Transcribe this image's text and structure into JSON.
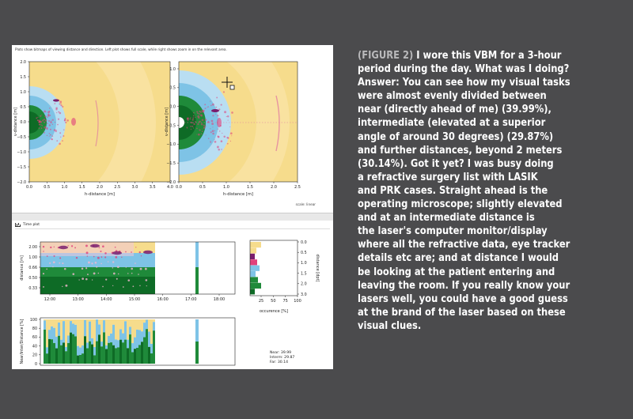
{
  "figure": {
    "header": "Plots show bitmaps of viewing distance and direction. Left plot shows full scale, while right shows zoom in on the relevant area.",
    "timeplot_title": "Time plot",
    "scale_label": "scale: linear"
  },
  "chart_data": [
    {
      "type": "heatmap",
      "title": "",
      "xlabel": "h-distance [m]",
      "ylabel": "v-distance [m]",
      "xlim": [
        0.0,
        4.0
      ],
      "ylim": [
        -2.0,
        2.0
      ],
      "xticks": [
        "0.0",
        "0.5",
        "1.0",
        "1.5",
        "2.0",
        "2.5",
        "3.0",
        "3.5",
        "4.0"
      ],
      "yticks": [
        "2.0",
        "1.5",
        "1.0",
        "0.5",
        "0.0",
        "−0.5",
        "−1.0",
        "−1.5",
        "−2.0"
      ]
    },
    {
      "type": "heatmap",
      "title": "",
      "xlabel": "h-distance [m]",
      "ylabel": "v-distance [m]",
      "xlim": [
        0.0,
        2.5
      ],
      "ylim": [
        -2.0,
        2.0
      ],
      "xticks": [
        "0.0",
        "0.5",
        "1.0",
        "1.5",
        "2.0",
        "2.5"
      ],
      "yticks": [
        "1.0",
        "0.5",
        "0.0",
        "−0.5",
        "−1.0",
        "−1.5",
        "−2.0"
      ]
    },
    {
      "type": "heatmap",
      "title": "Time plot",
      "xlabel": "",
      "ylabel": "distance [m]",
      "x": [
        "12:00",
        "13:00",
        "14:00",
        "15:00",
        "16:00",
        "17:00",
        "18:00"
      ],
      "yticks": [
        "2.00",
        "1.00",
        "0.66",
        "0.50",
        "0.33"
      ]
    },
    {
      "type": "bar",
      "title": "",
      "xlabel": "occurence [%]",
      "ylabel": "distance [dpt]",
      "xticks": [
        "25",
        "50",
        "75",
        "100"
      ],
      "yticks": [
        "0.0",
        "0.5",
        "1.0",
        "1.5",
        "2.0",
        "3.0"
      ]
    },
    {
      "type": "area",
      "title": "",
      "xlabel": "",
      "ylabel": "Near/Inter/Distance [%]",
      "yticks": [
        "100",
        "80",
        "60",
        "40",
        "20",
        "0"
      ],
      "series": [
        {
          "name": "Near",
          "values": [
            39.99
          ]
        },
        {
          "name": "Interm",
          "values": [
            29.87
          ]
        },
        {
          "name": "Far",
          "values": [
            30.14
          ]
        }
      ],
      "legend": [
        "Near: 39.99",
        "Interm: 29.87",
        "Far: 30.14"
      ]
    }
  ],
  "colors": {
    "near": "#1f8a3a",
    "near_dark": "#0e6b26",
    "intermediate": "#7ec3e6",
    "far": "#f6dc8c",
    "far_pale": "#fbe8b0",
    "hotspot": "#e0407a",
    "cluster": "#7a1d6e",
    "background": "#4b4b4d",
    "caption_label": "#b9b9bb"
  },
  "caption": {
    "label": "(FIGURE 2)",
    "lines": [
      "I wore this VBM for a 3-hour",
      "period during the day. What was I doing?",
      "Answer: You can see how my visual tasks",
      "were almost evenly divided between",
      "near (directly ahead of me) (39.99%),",
      "intermediate (elevated at a superior",
      "angle of around 30 degrees) (29.87%)",
      "and further distances, beyond 2 meters",
      "(30.14%). Got it yet? I was busy doing",
      "a refractive surgery list with LASIK",
      "and PRK cases. Straight ahead is the",
      "operating microscope; slightly elevated",
      "and at an intermediate distance is",
      "the laser's computer monitor/display",
      "where all the refractive data, eye tracker",
      "details etc are; and at distance I would",
      "be looking at the patient entering and",
      "leaving the room. If you really know your",
      "lasers well, you could have a good guess",
      "at the brand of the laser based on these",
      "visual clues."
    ]
  }
}
